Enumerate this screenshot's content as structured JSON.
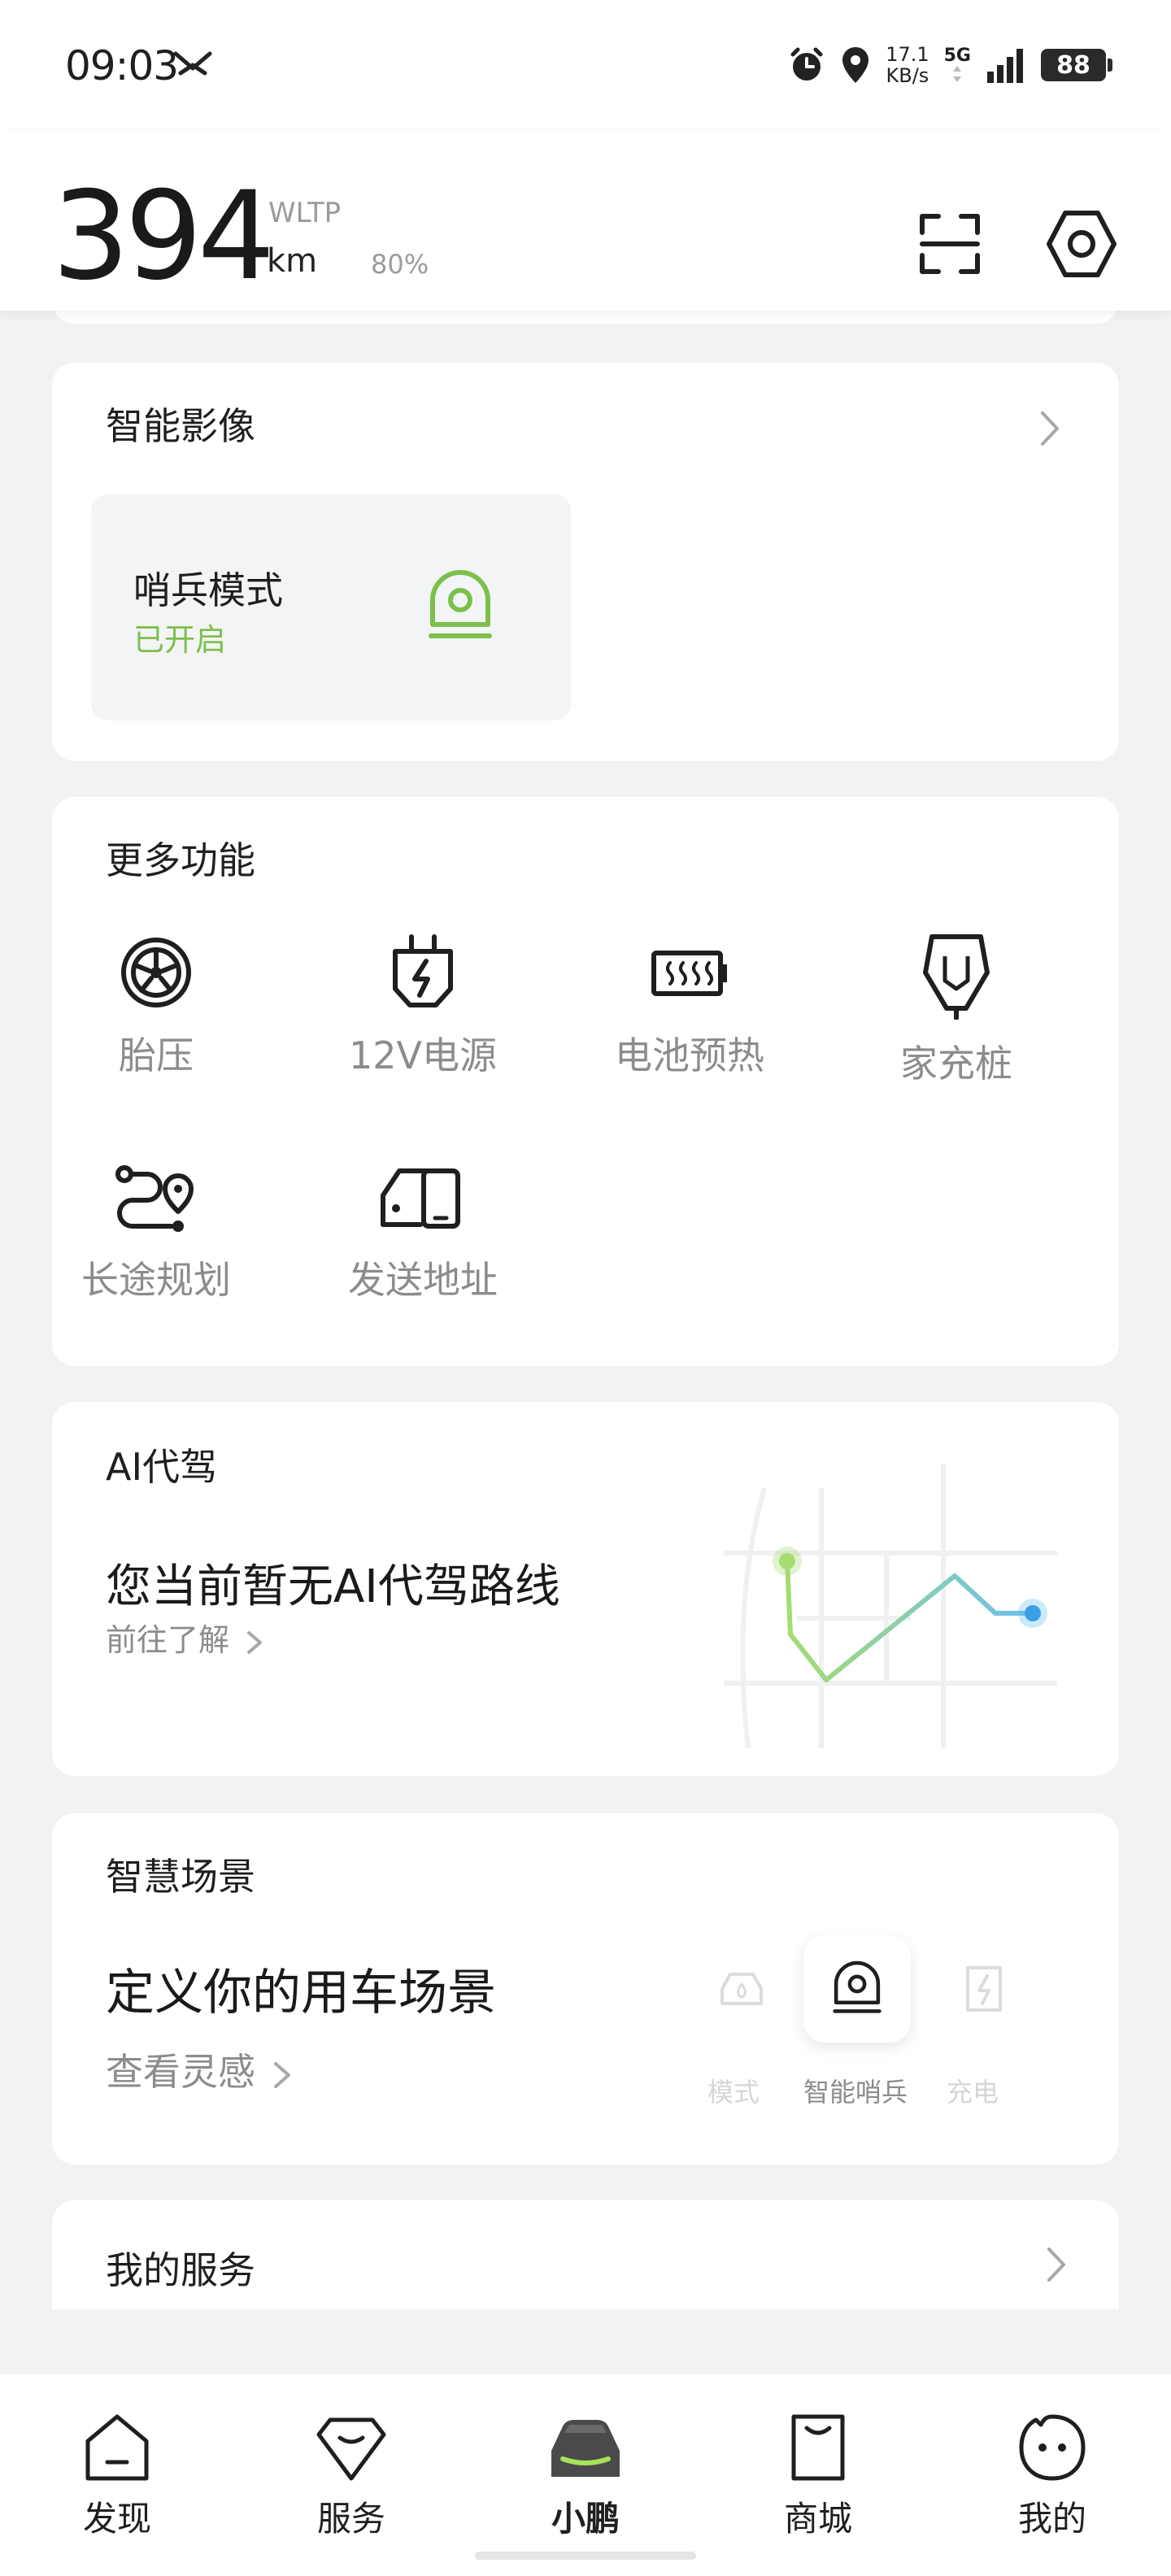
{
  "status_bar": {
    "time": "09:03",
    "app_icon": "xpeng-logo-icon",
    "network_speed_value": "17.1",
    "network_speed_unit": "KB/s",
    "network_type": "5G",
    "battery_level": "88"
  },
  "header": {
    "range_value": "394",
    "range_standard": "WLTP",
    "range_unit": "km",
    "battery_percent": "80%"
  },
  "smart_imaging": {
    "title": "智能影像",
    "sentry_mode": {
      "label": "哨兵模式",
      "status": "已开启",
      "status_color": "#7cc04b"
    }
  },
  "more_features": {
    "title": "更多功能",
    "items": [
      {
        "label": "胎压",
        "icon": "tire-icon"
      },
      {
        "label": "12V电源",
        "icon": "plug-icon"
      },
      {
        "label": "电池预热",
        "icon": "battery-heat-icon"
      },
      {
        "label": "家充桩",
        "icon": "charger-icon"
      },
      {
        "label": "长途规划",
        "icon": "route-icon"
      },
      {
        "label": "发送地址",
        "icon": "send-address-icon"
      }
    ]
  },
  "ai_driving": {
    "title": "AI代驾",
    "empty_text": "您当前暂无AI代驾路线",
    "link": "前往了解"
  },
  "smart_scenes": {
    "title": "智慧场景",
    "headline": "定义你的用车场景",
    "link": "查看灵感",
    "scenes": [
      {
        "label": "模式"
      },
      {
        "label": "智能哨兵"
      },
      {
        "label": "充电"
      }
    ]
  },
  "my_services": {
    "title": "我的服务"
  },
  "bottom_nav": {
    "active_color": "#a6e35a",
    "items": [
      {
        "label": "发现"
      },
      {
        "label": "服务"
      },
      {
        "label": "小鹏"
      },
      {
        "label": "商城"
      },
      {
        "label": "我的"
      }
    ]
  }
}
